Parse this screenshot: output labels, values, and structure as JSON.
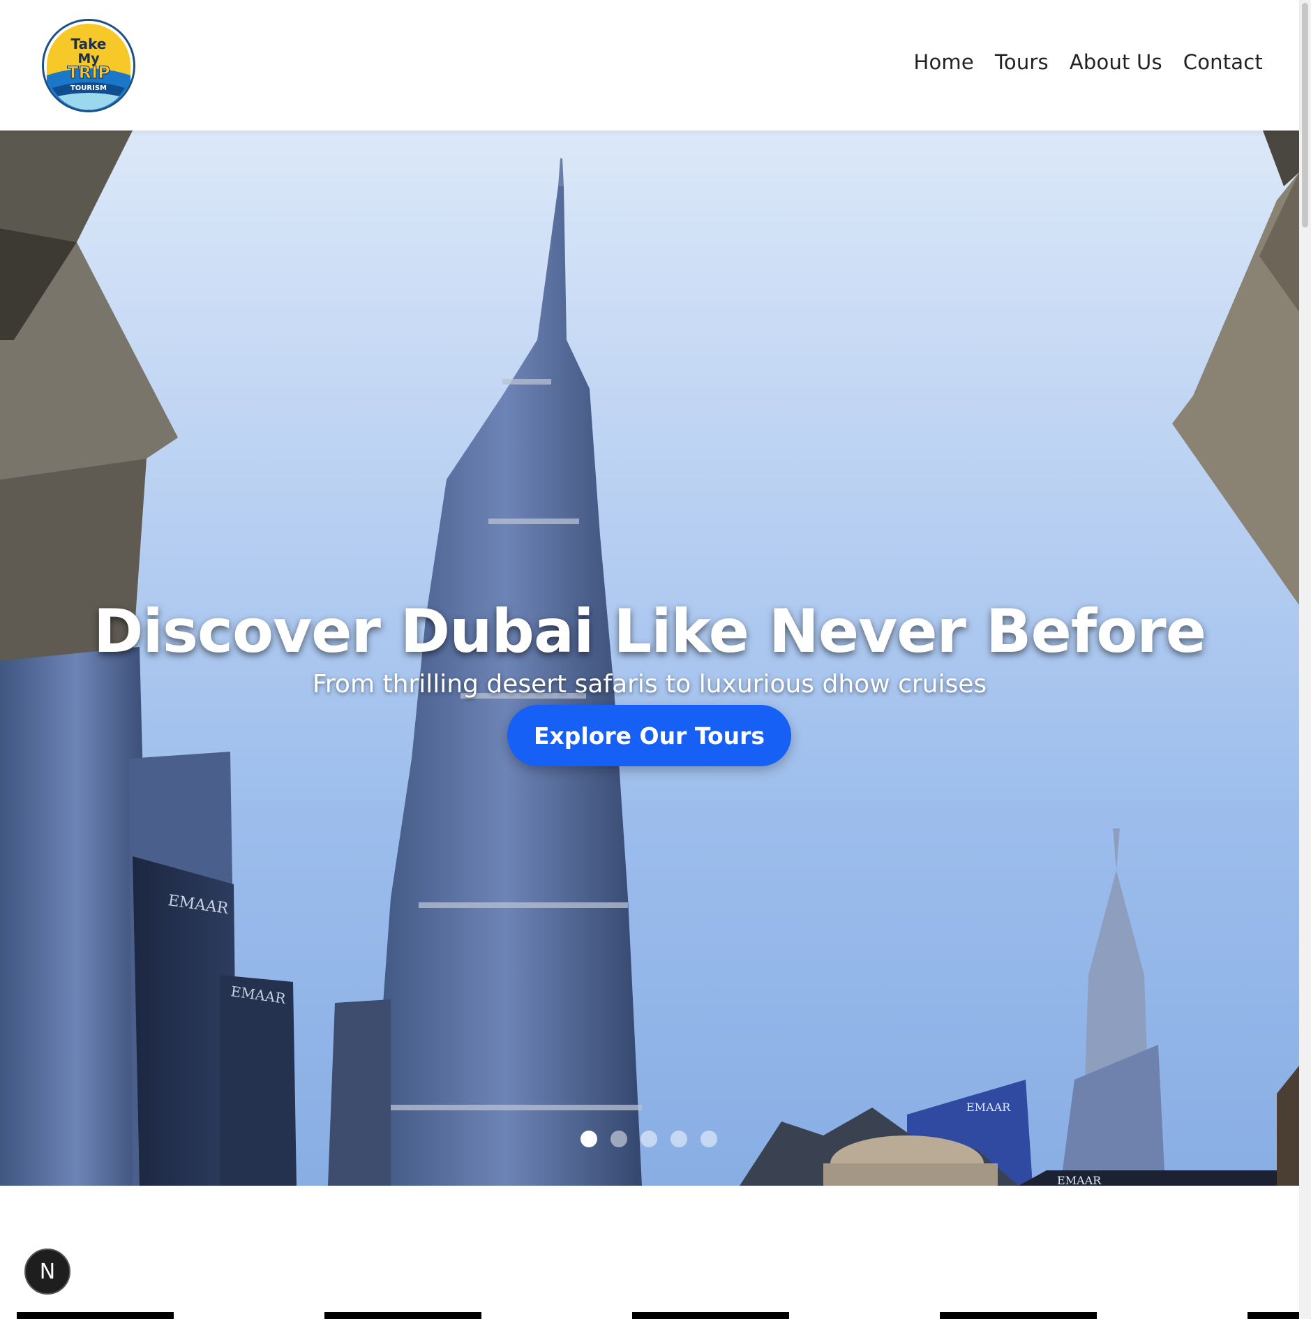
{
  "brand": {
    "logo_text_line1": "Take",
    "logo_text_line2": "My",
    "logo_text_line3": "TRIP",
    "logo_text_line4": "TOURISM"
  },
  "nav": {
    "items": [
      {
        "label": "Home"
      },
      {
        "label": "Tours"
      },
      {
        "label": "About Us"
      },
      {
        "label": "Contact"
      }
    ]
  },
  "hero": {
    "title": "Discover Dubai Like Never Before",
    "subtitle": "From thrilling desert safaris to luxurious dhow cruises",
    "cta_label": "Explore Our Tours",
    "slide_count": 5,
    "active_slide": 1,
    "building_signs": [
      "EMAAR",
      "EMAAR",
      "EMAAR",
      "EMAAR"
    ]
  },
  "floating_badge": {
    "label": "N",
    "icon": "nextjs-dev-icon"
  },
  "colors": {
    "accent": "#1660f5",
    "logo_blue": "#1b4f86",
    "logo_yellow": "#f6c928"
  }
}
